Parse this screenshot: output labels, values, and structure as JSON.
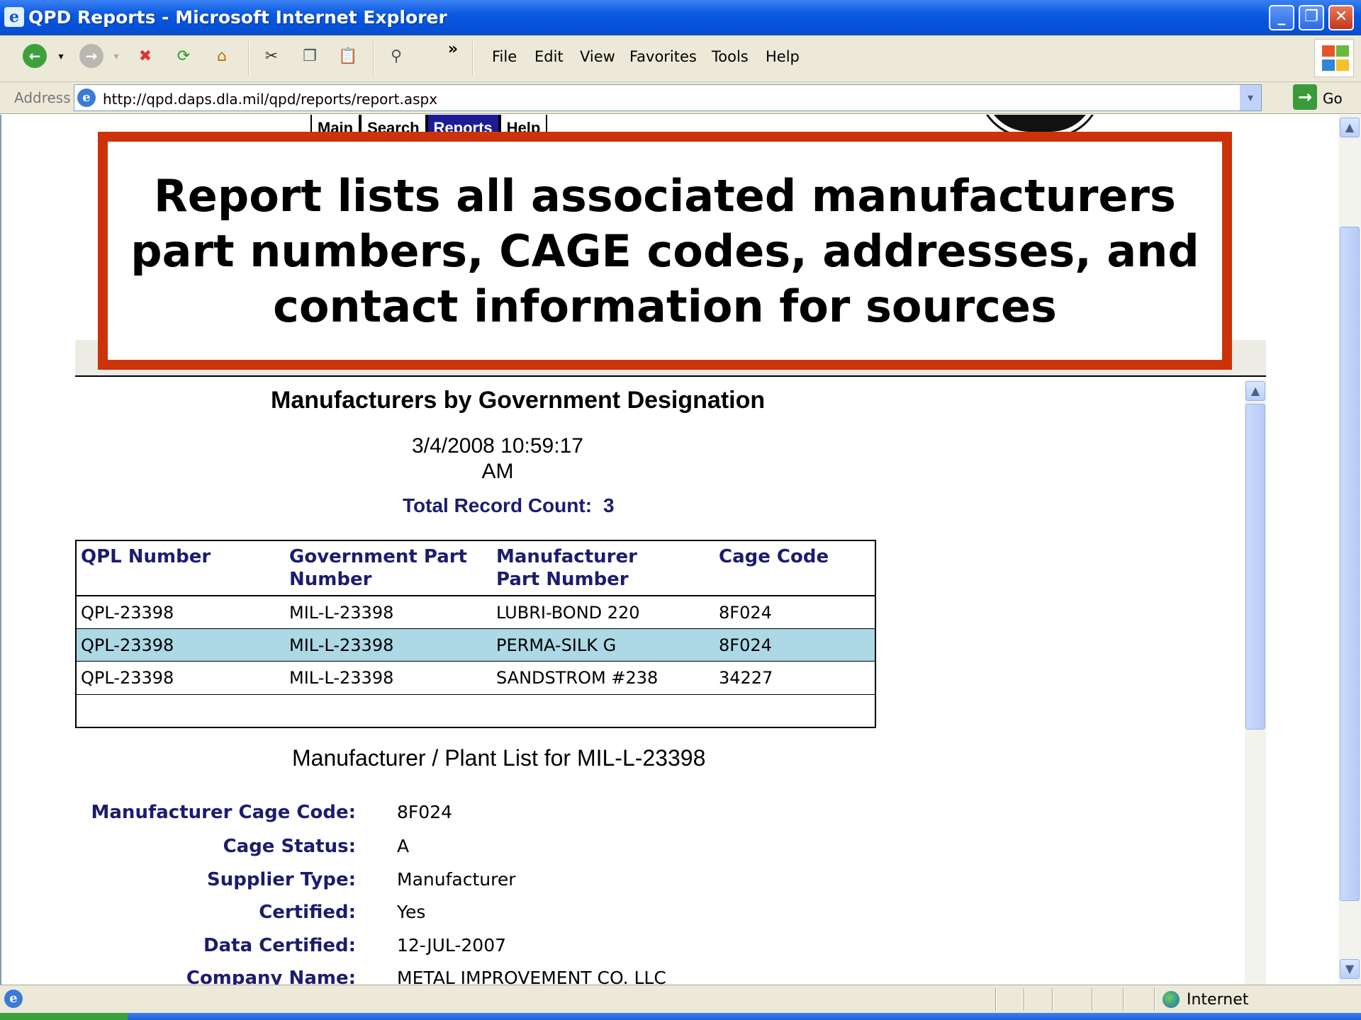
{
  "window": {
    "title": "QPD Reports - Microsoft Internet Explorer"
  },
  "menu": [
    "File",
    "Edit",
    "View",
    "Favorites",
    "Tools",
    "Help"
  ],
  "toolbar": {
    "chevron": "»"
  },
  "address": {
    "label": "Address",
    "url": "http://qpd.daps.dla.mil/qpd/reports/report.aspx",
    "go_label": "Go"
  },
  "nav_tabs": [
    "Main",
    "Search",
    "Reports",
    "Help"
  ],
  "callout": {
    "text": "Report lists all associated manufacturers part numbers, CAGE codes, addresses, and contact information for sources"
  },
  "report": {
    "title": "Manufacturers by Government Designation",
    "date_line1": "3/4/2008 10:59:17",
    "date_line2": "AM",
    "count_label": "Total Record Count:",
    "count_value": "3",
    "columns": [
      "QPL Number",
      "Government Part Number",
      "Manufacturer Part Number",
      "Cage Code"
    ],
    "rows": [
      [
        "QPL-23398",
        "MIL-L-23398",
        "LUBRI-BOND 220",
        "8F024"
      ],
      [
        "QPL-23398",
        "MIL-L-23398",
        "PERMA-SILK G",
        "8F024"
      ],
      [
        "QPL-23398",
        "MIL-L-23398",
        "SANDSTROM #238",
        "34227"
      ]
    ]
  },
  "plant": {
    "title": "Manufacturer / Plant List for MIL-L-23398",
    "fields": [
      {
        "label": "Manufacturer Cage Code:",
        "value": "8F024"
      },
      {
        "label": "Cage Status:",
        "value": "A"
      },
      {
        "label": "Supplier Type:",
        "value": "Manufacturer"
      },
      {
        "label": "Certified:",
        "value": "Yes"
      },
      {
        "label": "Data Certified:",
        "value": "12-JUL-2007"
      },
      {
        "label": "Company Name:",
        "value": "METAL IMPROVEMENT CO. LLC"
      }
    ]
  },
  "status": {
    "zone": "Internet"
  },
  "colors": {
    "callout_border": "#cc3308",
    "link_navy": "#1c1c6e",
    "row_highlight": "#add8e6"
  }
}
